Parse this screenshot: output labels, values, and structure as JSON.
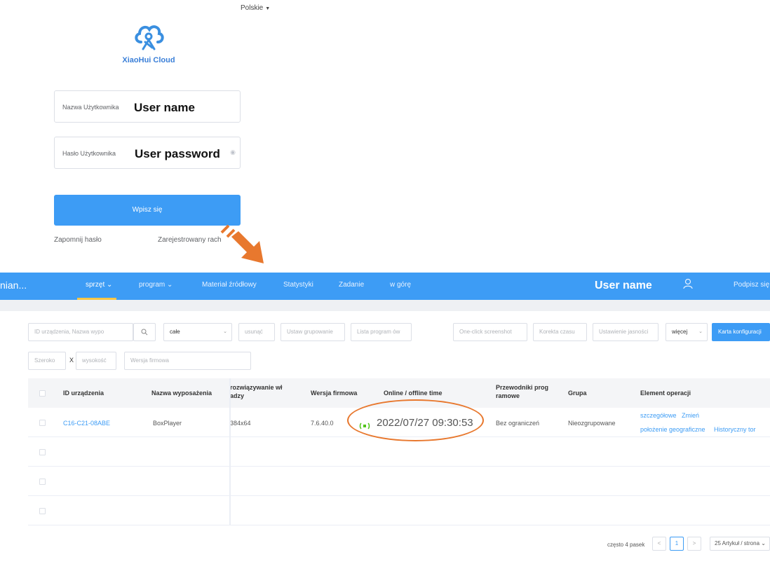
{
  "login": {
    "language": "Polskie",
    "logo_text": "XiaoHui Cloud",
    "username_label": "Nazwa Użytkownika",
    "username_value": "User name",
    "password_label": "Hasło Użytkownika",
    "password_value": "User password",
    "submit_label": "Wpisz się",
    "forgot_label": "Zapomnij hasło",
    "register_label": "Zarejestrowany rach"
  },
  "nav": {
    "brand": "nian...",
    "items": [
      {
        "label": "sprzęt ⌄"
      },
      {
        "label": "program ⌄"
      },
      {
        "label": "Materiał źródłowy"
      },
      {
        "label": "Statystyki"
      },
      {
        "label": "Zadanie"
      },
      {
        "label": "w górę"
      }
    ],
    "user": "User name",
    "signout": "Podpisz się"
  },
  "toolbar": {
    "search_placeholder": "ID urządzenia, Nazwa wypo",
    "group_select": "całe",
    "delete": "usunąć",
    "set_group": "Ustaw grupowanie",
    "program_list": "Lista program ów",
    "screenshot": "One-click screenshot",
    "time_fix": "Korekta czasu",
    "brightness": "Ustawienie jasności",
    "more": "więcej",
    "config_card": "Karta konfiguracji",
    "width_placeholder": "Szeroko",
    "x_label": "X",
    "height_placeholder": "wysokość",
    "firmware_placeholder": "Wersja firmowa"
  },
  "table": {
    "headers": {
      "device_id": "ID urządzenia",
      "device_name": "Nazwa wyposażenia",
      "resolution": "rozwiązywanie wł adzy",
      "firmware": "Wersja firmowa",
      "online_time": "Online / offline time",
      "frame_guides": "Przewodniki prog ramowe",
      "group": "Grupa",
      "operation": "Element operacji"
    },
    "rows": [
      {
        "device_id": "C16-C21-08ABE",
        "device_name": "BoxPlayer",
        "resolution": "384x64",
        "firmware": "7.6.40.0",
        "online_time": "2022/07/27 09:30:53",
        "frame_guides": "Bez ograniczeń",
        "group": "Nieozgrupowane",
        "op_details": "szczegółowe",
        "op_change": "Zmień",
        "op_location": "położenie geograficzne",
        "op_history": "Historyczny tor"
      }
    ]
  },
  "pagination": {
    "total_text": "często 4 pasek",
    "prev": "<",
    "current_page": "1",
    "next": ">",
    "page_size": "25 Artykuł / strona ⌄"
  },
  "colors": {
    "primary": "#3d9cf5",
    "accent_nav": "#f7c646",
    "annotation": "#e8782e",
    "online": "#52c41a"
  }
}
